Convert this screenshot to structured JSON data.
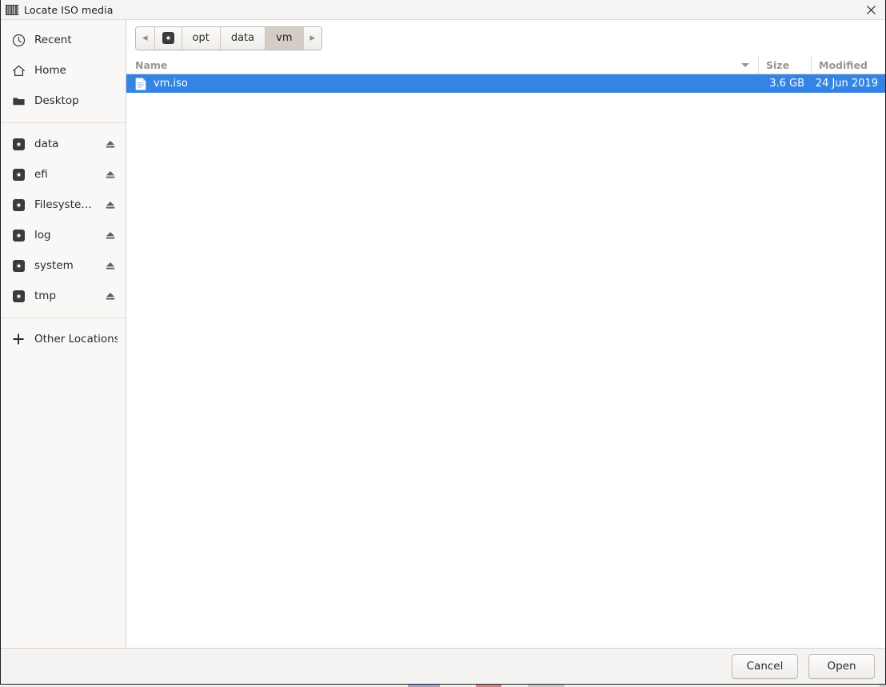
{
  "window": {
    "title": "Locate ISO media",
    "icon": "app-icon",
    "close_label": "×"
  },
  "sidebar": {
    "places": [
      {
        "label": "Recent",
        "icon": "clock-icon"
      },
      {
        "label": "Home",
        "icon": "home-icon"
      },
      {
        "label": "Desktop",
        "icon": "folder-icon"
      }
    ],
    "devices": [
      {
        "label": "data",
        "icon": "drive-icon",
        "eject": "eject-icon"
      },
      {
        "label": "efi",
        "icon": "drive-icon",
        "eject": "eject-icon"
      },
      {
        "label": "Filesyste…",
        "icon": "drive-icon",
        "eject": "eject-icon"
      },
      {
        "label": "log",
        "icon": "drive-icon",
        "eject": "eject-icon"
      },
      {
        "label": "system",
        "icon": "drive-icon",
        "eject": "eject-icon"
      },
      {
        "label": "tmp",
        "icon": "drive-icon",
        "eject": "eject-icon"
      }
    ],
    "other_locations": {
      "label": "Other Locations",
      "icon": "plus-icon"
    }
  },
  "pathbar": {
    "prev_arrow": "◂",
    "next_arrow": "▸",
    "root_icon": "drive-icon",
    "crumbs": [
      {
        "label": "opt",
        "active": false
      },
      {
        "label": "data",
        "active": false
      },
      {
        "label": "vm",
        "active": true
      }
    ]
  },
  "file_list": {
    "columns": [
      {
        "key": "name",
        "label": "Name",
        "sorted": "descending"
      },
      {
        "key": "size",
        "label": "Size"
      },
      {
        "key": "modified",
        "label": "Modified"
      }
    ],
    "rows": [
      {
        "name": "vm.iso",
        "size": "3.6 GB",
        "modified": "24 Jun 2019",
        "icon": "document-icon",
        "selected": true
      }
    ]
  },
  "footer": {
    "cancel_label": "Cancel",
    "open_label": "Open"
  },
  "colors": {
    "selection_blue": "#3584e4",
    "sidebar_bg": "#f9f8f7",
    "footer_bg": "#f4f3f2",
    "titlebar_bg": "#f5f4f2",
    "header_text": "#9a958e"
  }
}
